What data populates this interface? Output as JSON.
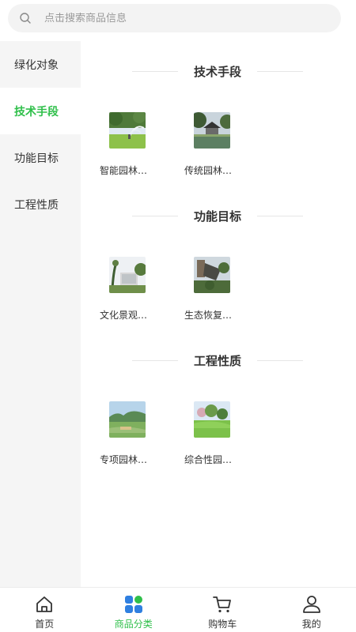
{
  "search": {
    "placeholder": "点击搜索商品信息"
  },
  "sidebar": {
    "items": [
      {
        "label": "绿化对象",
        "active": false
      },
      {
        "label": "技术手段",
        "active": true
      },
      {
        "label": "功能目标",
        "active": false
      },
      {
        "label": "工程性质",
        "active": false
      }
    ]
  },
  "sections": [
    {
      "title": "技术手段",
      "items": [
        {
          "name": "智能园林…",
          "image": "sprinkler-lawn-photo"
        },
        {
          "name": "传统园林…",
          "image": "pavilion-pond-photo"
        }
      ]
    },
    {
      "title": "功能目标",
      "items": [
        {
          "name": "文化景观…",
          "image": "cultural-wall-photo"
        },
        {
          "name": "生态恢复…",
          "image": "restoration-site-photo"
        }
      ]
    },
    {
      "title": "工程性质",
      "items": [
        {
          "name": "专项园林…",
          "image": "landscape-hills-photo"
        },
        {
          "name": "综合性园…",
          "image": "garden-lawn-photo"
        }
      ]
    }
  ],
  "tabbar": {
    "items": [
      {
        "label": "首页",
        "icon": "home-icon",
        "active": false
      },
      {
        "label": "商品分类",
        "icon": "category-icon",
        "active": true
      },
      {
        "label": "购物车",
        "icon": "cart-icon",
        "active": false
      },
      {
        "label": "我的",
        "icon": "user-icon",
        "active": false
      }
    ]
  },
  "colors": {
    "accent": "#2fbf4a",
    "category_blue": "#2f7fe0",
    "sidebar_bg": "#f5f5f5"
  }
}
